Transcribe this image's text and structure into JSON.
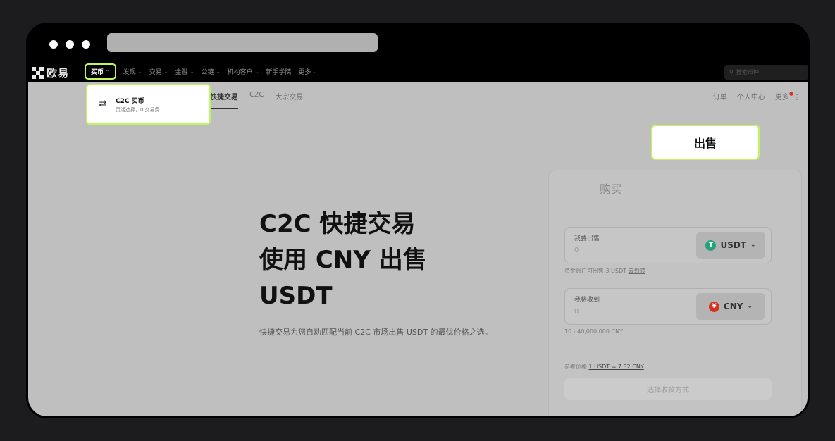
{
  "nav": {
    "logo_text": "欧易",
    "items": [
      {
        "label": "买币",
        "active": true
      },
      {
        "label": "发现"
      },
      {
        "label": "交易"
      },
      {
        "label": "金融"
      },
      {
        "label": "公链"
      },
      {
        "label": "机构客户"
      },
      {
        "label": "新手学院"
      },
      {
        "label": "更多"
      }
    ],
    "search_placeholder": "搜索币种"
  },
  "subnav": {
    "tabs": [
      "快捷交易",
      "C2C",
      "大宗交易"
    ],
    "right": [
      "订单",
      "个人中心",
      "更多"
    ]
  },
  "dropdown": {
    "title": "C2C 买币",
    "subtitle": "灵活选择，0 交易费"
  },
  "hero": {
    "line1": "C2C 快捷交易",
    "line2": "使用 CNY 出售",
    "line3": "USDT",
    "desc": "快捷交易为您自动匹配当前 C2C 市场出售 USDT 的最优价格之选。"
  },
  "panel": {
    "tab_buy": "购买",
    "tab_sell": "出售",
    "sell_label": "我要出售",
    "sell_placeholder": "0",
    "sell_coin": "USDT",
    "available": "资金账户可出售 3 USDT",
    "transfer": "去划转",
    "receive_label": "我将收到",
    "receive_placeholder": "0",
    "receive_coin": "CNY",
    "range": "10 - 40,000,000 CNY",
    "ref_label": "参考价格",
    "ref_value": "1 USDT ≈ 7.32 CNY",
    "submit": "选择收款方式"
  },
  "colors": {
    "highlight": "#bff55f",
    "usdt": "#26a17b",
    "cny": "#d6311f"
  }
}
